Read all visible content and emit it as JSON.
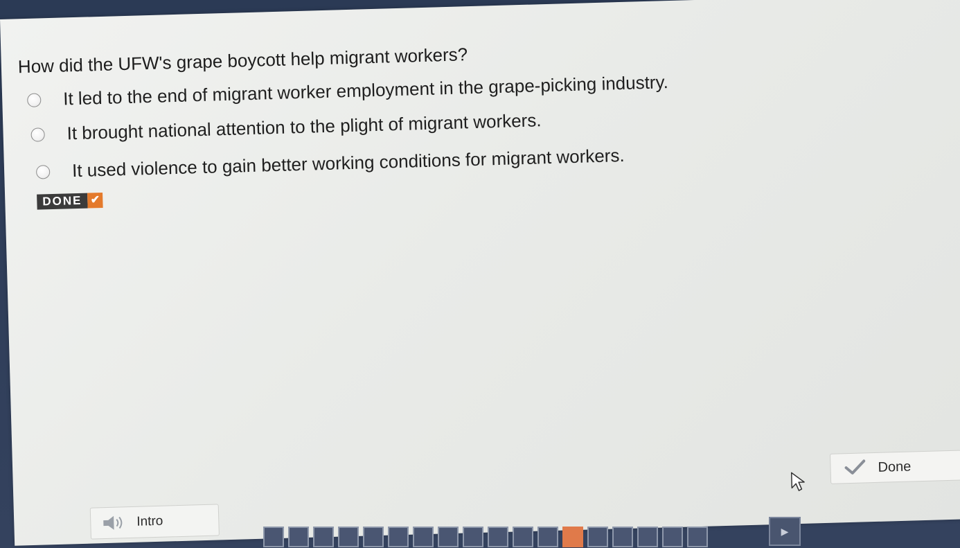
{
  "question": {
    "text": "How did the UFW's grape boycott help migrant workers?"
  },
  "options": [
    {
      "text": "It led to the end of migrant worker employment in the grape-picking industry."
    },
    {
      "text": "It brought national attention to the plight of migrant workers."
    },
    {
      "text": "It used violence to gain better working conditions for migrant workers."
    }
  ],
  "done_badge": {
    "label": "DONE",
    "check": "✔"
  },
  "done_button": {
    "label": "Done",
    "icon": "check-icon"
  },
  "intro_button": {
    "label": "Intro",
    "icon": "speaker-icon"
  },
  "colors": {
    "accent": "#e47a2c",
    "badge_dark": "#3b3b3b",
    "frame": "#34425e"
  }
}
